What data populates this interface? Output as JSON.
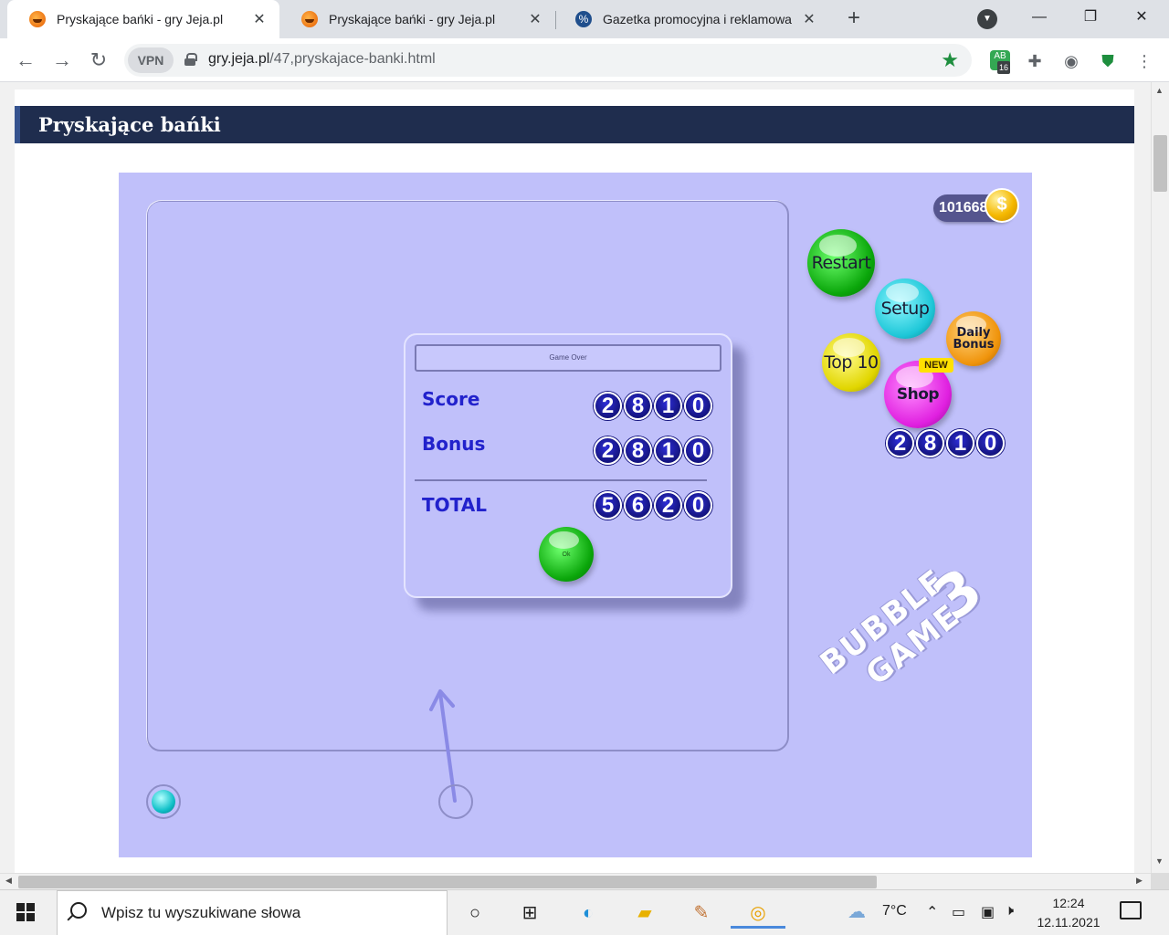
{
  "tabs": [
    {
      "title": "Pryskające bańki - gry Jeja.pl",
      "active": true
    },
    {
      "title": "Pryskające bańki - gry Jeja.pl",
      "active": false
    },
    {
      "title": "Gazetka promocyjna i reklamowa",
      "active": false
    }
  ],
  "toolbar": {
    "vpn_label": "VPN",
    "url_host": "gry.jeja.pl",
    "url_path": "/47,pryskajace-banki.html",
    "ext_badge": "16",
    "ext_label": "AB"
  },
  "page": {
    "heading": "Pryskające bańki"
  },
  "game": {
    "coins": "1016681",
    "coin_symbol": "$",
    "menu": {
      "restart": "Restart",
      "setup": "Setup",
      "top10": "Top 10",
      "daily_bonus_line1": "Daily",
      "daily_bonus_line2": "Bonus",
      "shop": "Shop",
      "new_badge": "NEW"
    },
    "side_score": [
      "2",
      "8",
      "1",
      "0"
    ],
    "logo_line1": "BUBBLE",
    "logo_line2": "GAME",
    "logo_number": "3",
    "dialog": {
      "title": "Game Over",
      "score_label": "Score",
      "score": [
        "2",
        "8",
        "1",
        "0"
      ],
      "bonus_label": "Bonus",
      "bonus": [
        "2",
        "8",
        "1",
        "0"
      ],
      "total_label": "TOTAL",
      "total": [
        "5",
        "6",
        "2",
        "0"
      ],
      "ok_label": "Ok"
    }
  },
  "taskbar": {
    "search_placeholder": "Wpisz tu wyszukiwane słowa",
    "temperature": "7°C",
    "time": "12:24",
    "date": "12.11.2021"
  }
}
